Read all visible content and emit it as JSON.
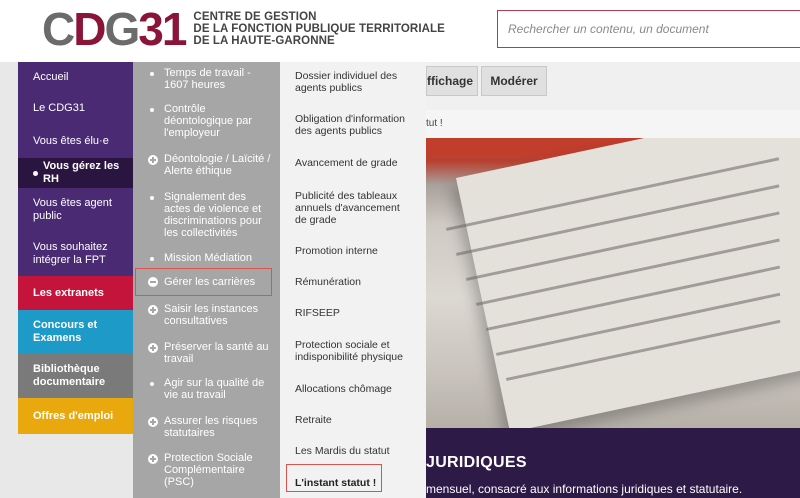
{
  "header": {
    "logo_mark": "CDG31",
    "logo_line1": "CENTRE DE GESTION",
    "logo_line2": "DE LA FONCTION PUBLIQUE TERRITORIALE",
    "logo_line3": "DE LA HAUTE-GARONNE",
    "search_placeholder": "Rechercher un contenu, un document"
  },
  "background": {
    "tabs": [
      "ffichage",
      "Modérer"
    ],
    "strip_text": "tut !",
    "band_title": "JURIDIQUES",
    "band_sub": "mensuel, consacré aux informations juridiques et statutaire."
  },
  "nav1": {
    "items": [
      {
        "label": "Accueil",
        "color": "#4a2a73"
      },
      {
        "label": "Le CDG31",
        "color": "#4a2a73"
      },
      {
        "label": "Vous êtes élu·e",
        "color": "#4a2a73"
      },
      {
        "label": "Vous gérez les RH",
        "color": "#2a1540",
        "active": true
      },
      {
        "label": "Vous êtes agent public",
        "color": "#4a2a73"
      },
      {
        "label": "Vous souhaitez intégrer la FPT",
        "color": "#4a2a73"
      },
      {
        "label": "Les extranets",
        "color": "#c4143c"
      },
      {
        "label": "Concours et Examens",
        "color": "#1e9ac8"
      },
      {
        "label": "Bibliothèque documentaire",
        "color": "#7a7a7a"
      },
      {
        "label": "Offres d'emploi",
        "color": "#e8a80e"
      }
    ]
  },
  "nav2": {
    "items": [
      {
        "label": "Temps de travail - 1607 heures",
        "icon": "bullet"
      },
      {
        "label": "Contrôle déontologique par l'employeur",
        "icon": "bullet"
      },
      {
        "label": "Déontologie / Laïcité / Alerte éthique",
        "icon": "plus"
      },
      {
        "label": "Signalement des actes de violence et discriminations pour les collectivités",
        "icon": "bullet"
      },
      {
        "label": "Mission Médiation",
        "icon": "bullet"
      },
      {
        "label": "Gérer les carrières",
        "icon": "minus",
        "selected": true
      },
      {
        "label": "Saisir les instances consultatives",
        "icon": "plus"
      },
      {
        "label": "Préserver la santé au travail",
        "icon": "plus"
      },
      {
        "label": "Agir sur la qualité de vie au travail",
        "icon": "bullet"
      },
      {
        "label": "Assurer les risques statutaires",
        "icon": "plus"
      },
      {
        "label": "Protection Sociale Complémentaire (PSC)",
        "icon": "plus"
      }
    ]
  },
  "nav3": {
    "items": [
      "Dossier individuel des agents publics",
      "Obligation d'information des agents publics",
      "Avancement de grade",
      "Publicité des tableaux annuels d'avancement de grade",
      "Promotion interne",
      "Rémunération",
      "RIFSEEP",
      "Protection sociale et indisponibilité physique",
      "Allocations chômage",
      "Retraite",
      "Les Mardis du statut",
      "L'instant statut !"
    ]
  }
}
